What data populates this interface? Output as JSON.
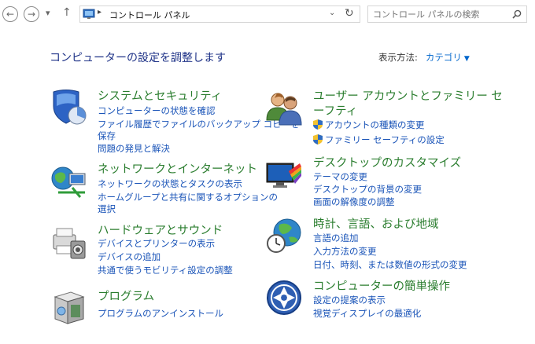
{
  "address_bar": {
    "path": "コントロール パネル",
    "search_placeholder": "コントロール パネルの検索"
  },
  "heading": "コンピューターの設定を調整します",
  "view_by": {
    "label": "表示方法:",
    "value": "カテゴリ"
  },
  "categories": [
    {
      "title": "システムとセキュリティ",
      "links": [
        "コンピューターの状態を確認",
        "ファイル履歴でファイルのバックアップ コピーを",
        "保存",
        "問題の発見と解決"
      ]
    },
    {
      "title": "ネットワークとインターネット",
      "links": [
        "ネットワークの状態とタスクの表示",
        "ホームグループと共有に関するオプションの",
        "選択"
      ]
    },
    {
      "title": "ハードウェアとサウンド",
      "links": [
        "デバイスとプリンターの表示",
        "デバイスの追加",
        "共通で使うモビリティ設定の調整"
      ]
    },
    {
      "title": "プログラム",
      "links": [
        "プログラムのアンインストール"
      ]
    },
    {
      "title_line1": "ユーザー アカウントとファミリー セ",
      "title_line2": "ーフティ",
      "links": [
        "アカウントの種類の変更",
        "ファミリー セーフティの設定"
      ]
    },
    {
      "title": "デスクトップのカスタマイズ",
      "links": [
        "テーマの変更",
        "デスクトップの背景の変更",
        "画面の解像度の調整"
      ]
    },
    {
      "title": "時計、言語、および地域",
      "links": [
        "言語の追加",
        "入力方法の変更",
        "日付、時刻、または数値の形式の変更"
      ]
    },
    {
      "title": "コンピューターの簡単操作",
      "links": [
        "設定の提案の表示",
        "視覚ディスプレイの最適化"
      ]
    }
  ]
}
